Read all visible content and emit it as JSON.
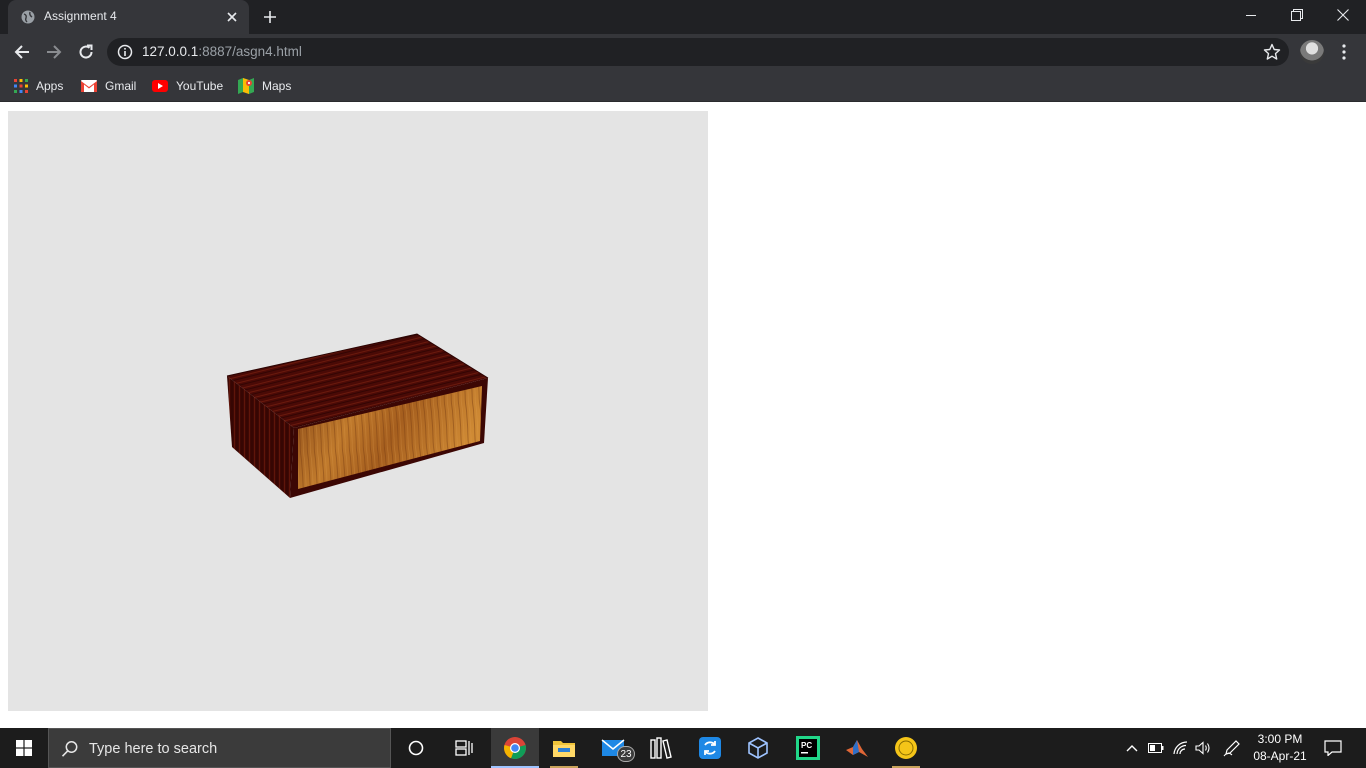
{
  "browser": {
    "tab": {
      "title": "Assignment 4",
      "favicon": "globe-icon"
    },
    "url": {
      "host": "127.0.0.1",
      "rest": ":8887/asgn4.html"
    },
    "bookmarks": [
      {
        "label": "Apps",
        "icon": "apps-grid-icon"
      },
      {
        "label": "Gmail",
        "icon": "gmail-icon"
      },
      {
        "label": "YouTube",
        "icon": "youtube-icon"
      },
      {
        "label": "Maps",
        "icon": "maps-icon"
      }
    ]
  },
  "page": {
    "canvas_background": "#e4e4e4",
    "scene": {
      "object": "box",
      "colors": {
        "dark_wood": "#4a0a06",
        "light_wood": "#b86a22"
      }
    }
  },
  "taskbar": {
    "search_placeholder": "Type here to search",
    "apps": [
      "cortana-icon",
      "task-view-icon",
      "chrome-icon",
      "file-explorer-icon",
      "mail-icon",
      "library-icon",
      "sync-icon",
      "virtualbox-icon",
      "pycharm-icon",
      "matlab-icon",
      "app-icon"
    ],
    "mail_badge": "23",
    "clock": {
      "time": "3:00 PM",
      "date": "08-Apr-21"
    }
  },
  "colors": {
    "chrome_dark": "#202124",
    "chrome_mid": "#35363a",
    "taskbar": "#1c1c1c"
  }
}
